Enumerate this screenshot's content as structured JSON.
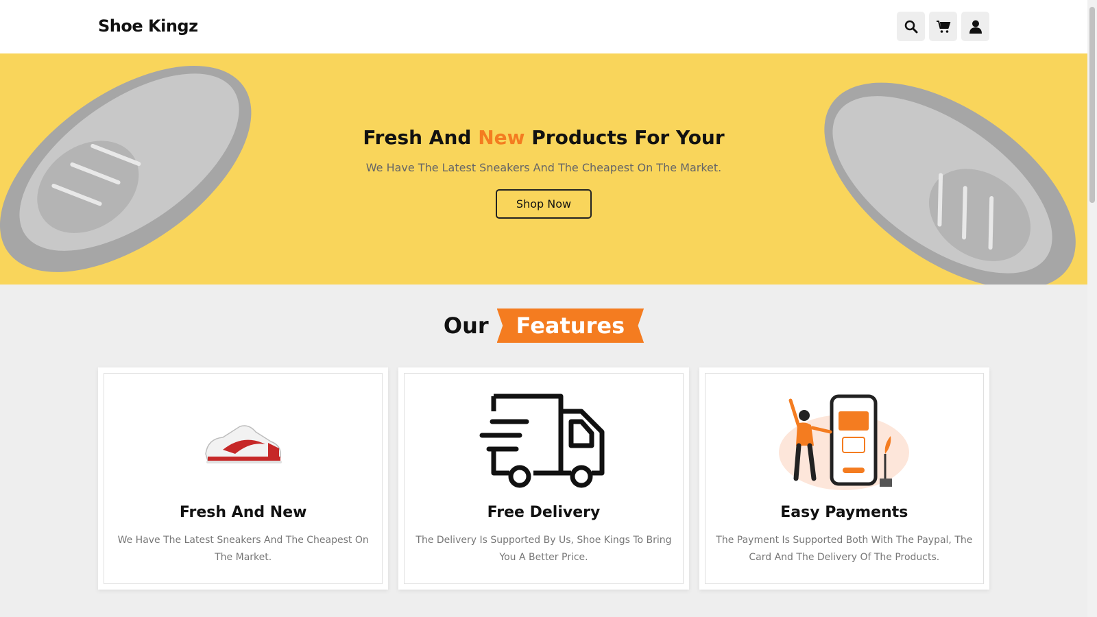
{
  "header": {
    "logo": "Shoe Kingz",
    "icons": [
      "search-icon",
      "cart-icon",
      "user-icon"
    ]
  },
  "hero": {
    "title_part1": "Fresh And ",
    "title_accent": "New",
    "title_part2": " Products For Your",
    "subtitle": "We Have The Latest Sneakers And The Cheapest On The Market.",
    "button": "Shop Now"
  },
  "features": {
    "heading_plain": "Our",
    "heading_tag": "Features",
    "cards": [
      {
        "title": "Fresh And New",
        "text": "We Have The Latest Sneakers And The Cheapest On The Market.",
        "icon": "sneaker-image"
      },
      {
        "title": "Free Delivery",
        "text": "The Delivery Is Supported By Us, Shoe Kings To Bring You A Better Price.",
        "icon": "delivery-truck-icon"
      },
      {
        "title": "Easy Payments",
        "text": "The Payment Is Supported Both With The Paypal, The Card And The Delivery Of The Products.",
        "icon": "payment-illustration"
      }
    ]
  },
  "colors": {
    "accent": "#f47c20",
    "hero_bg": "#f9d55b",
    "page_bg": "#eeeeee"
  }
}
